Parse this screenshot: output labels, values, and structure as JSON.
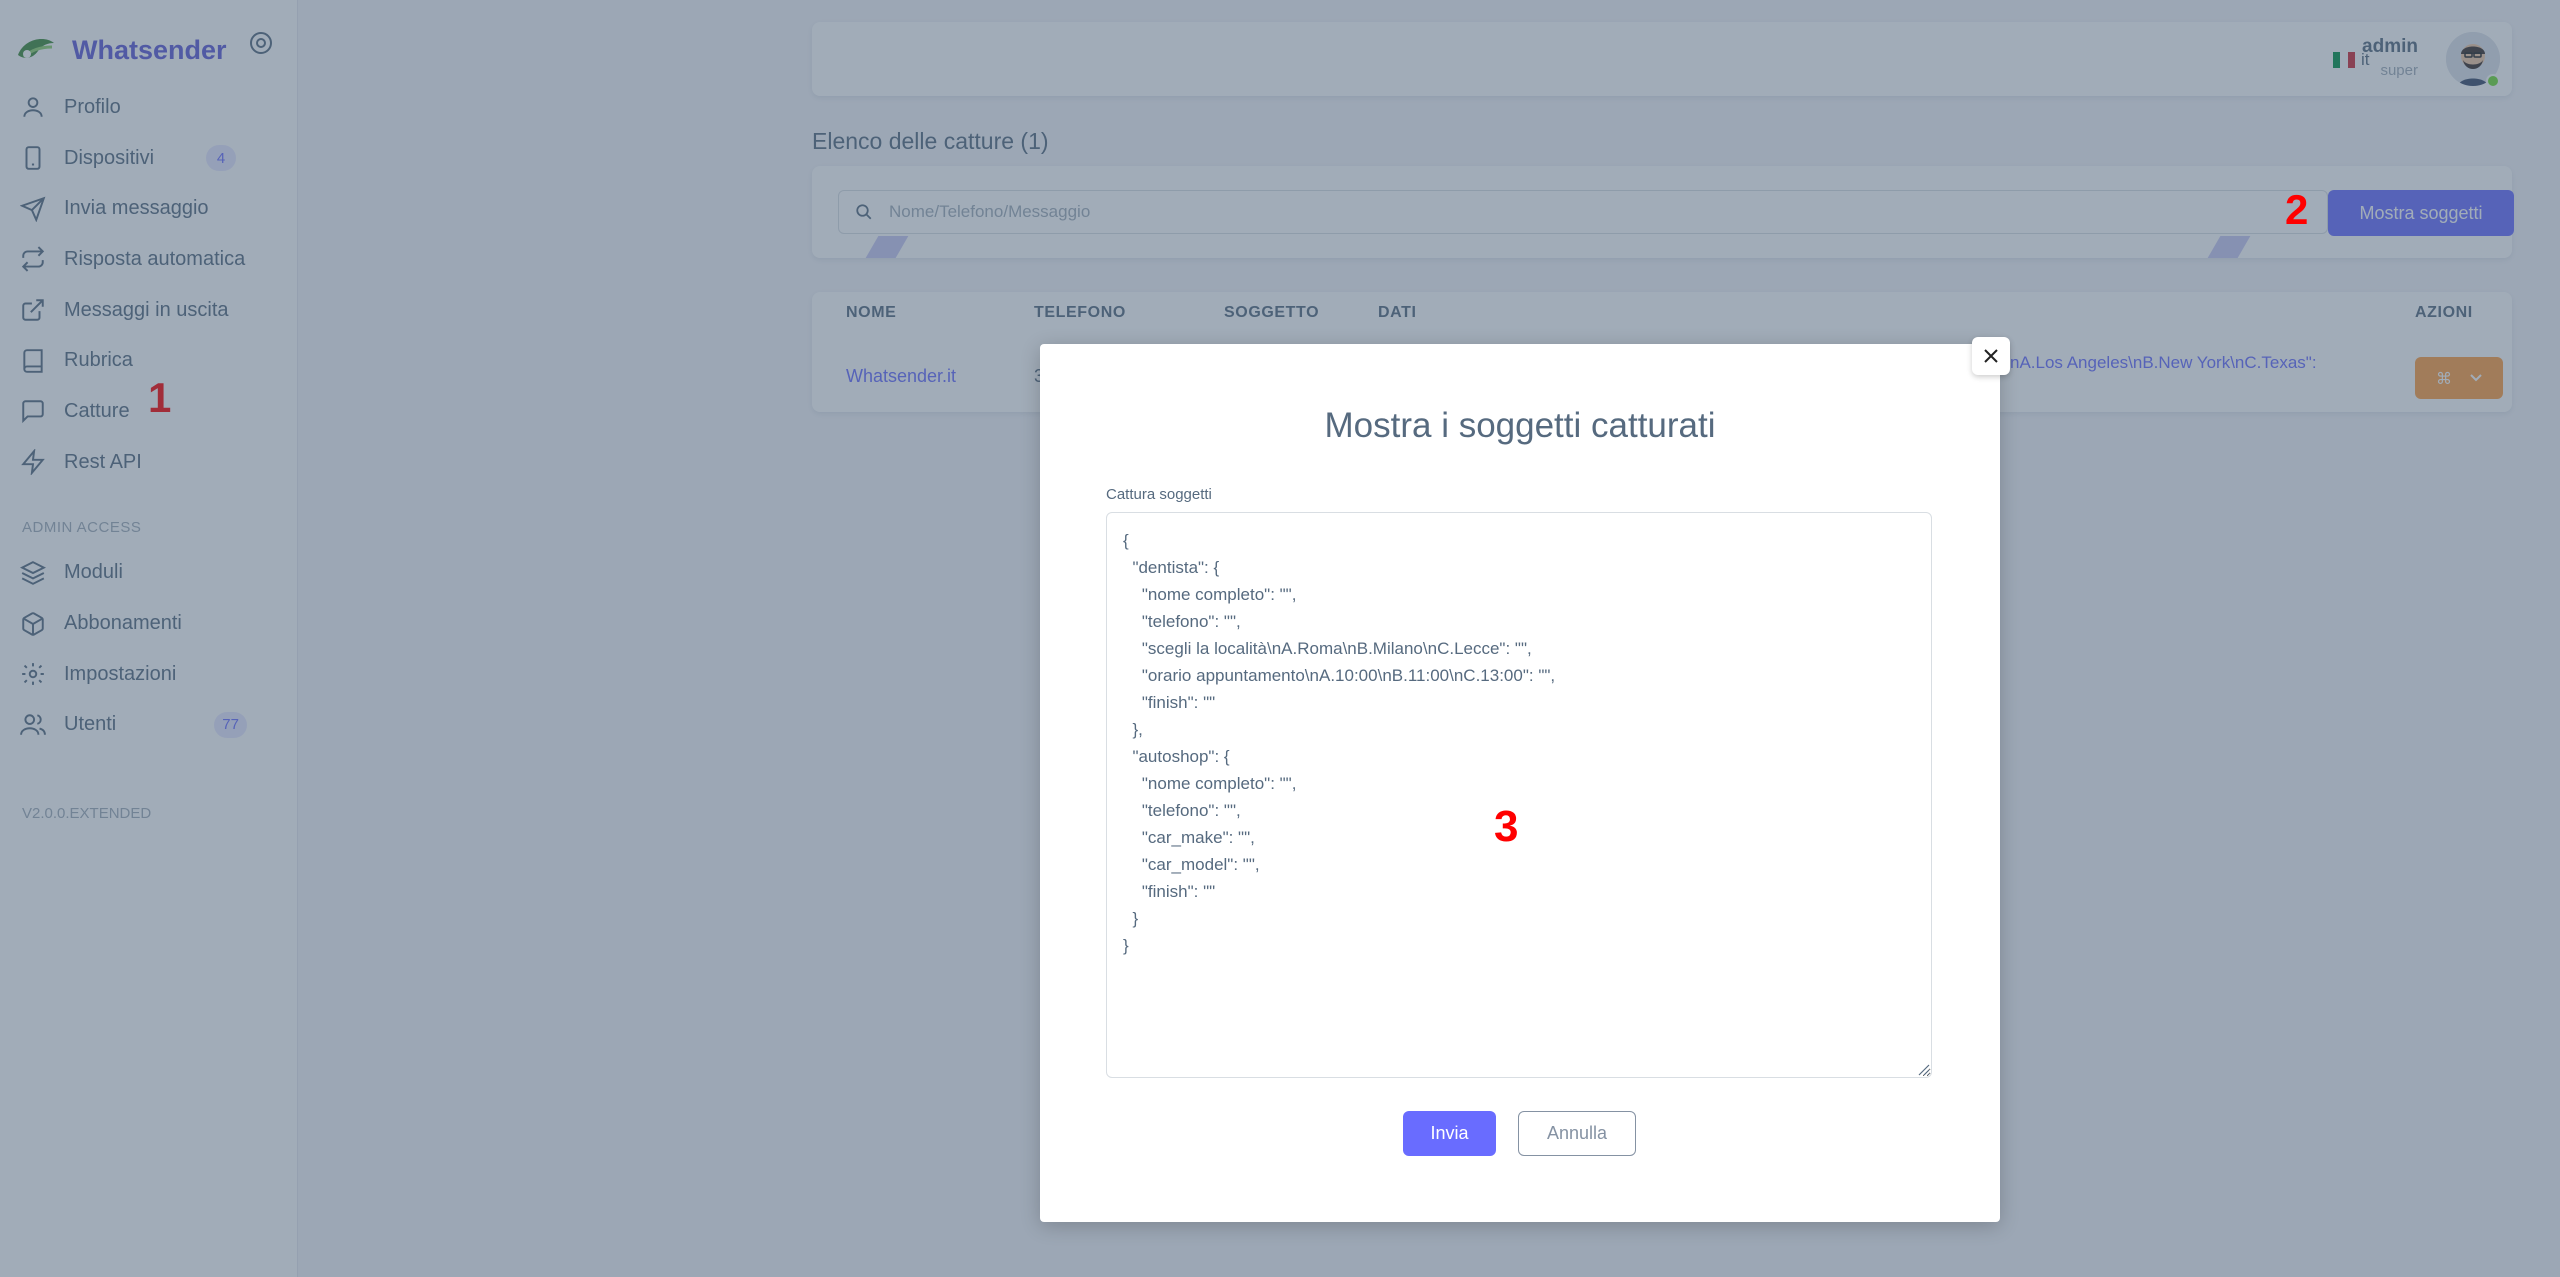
{
  "app": {
    "name": "Whatsender",
    "version": "V2.0.0.EXTENDED"
  },
  "sidebar": {
    "items": [
      {
        "label": "Profilo",
        "icon": "user-icon"
      },
      {
        "label": "Dispositivi",
        "icon": "smartphone-icon",
        "badge": "4"
      },
      {
        "label": "Invia messaggio",
        "icon": "send-icon"
      },
      {
        "label": "Risposta automatica",
        "icon": "repeat-icon"
      },
      {
        "label": "Messaggi in uscita",
        "icon": "external-link-icon"
      },
      {
        "label": "Rubrica",
        "icon": "book-icon"
      },
      {
        "label": "Catture",
        "icon": "message-square-icon"
      },
      {
        "label": "Rest API",
        "icon": "zap-icon"
      }
    ],
    "admin_header": "ADMIN ACCESS",
    "admin_items": [
      {
        "label": "Moduli",
        "icon": "layers-icon"
      },
      {
        "label": "Abbonamenti",
        "icon": "package-icon"
      },
      {
        "label": "Impostazioni",
        "icon": "settings-icon"
      },
      {
        "label": "Utenti",
        "icon": "users-icon",
        "badge": "77"
      }
    ]
  },
  "navbar": {
    "lang": "it",
    "user_name": "admin",
    "user_role": "super"
  },
  "page": {
    "title": "Elenco delle catture (1)",
    "search_placeholder": "Nome/Telefono/Messaggio",
    "show_button": "Mostra soggetti"
  },
  "table": {
    "headers": [
      "NOME",
      "TELEFONO",
      "SOGGETTO",
      "DATI",
      "AZIONI"
    ],
    "rows": [
      {
        "nome": "Whatsender.it",
        "telefono": "3",
        "dati": "nA.Los Angeles\\nB.New York\\nC.Texas\":"
      }
    ]
  },
  "modal": {
    "title": "Mostra i soggetti catturati",
    "field_label": "Cattura soggetti",
    "textarea_value": "{\n  \"dentista\": {\n    \"nome completo\": \"\",\n    \"telefono\": \"\",\n    \"scegli la località\\nA.Roma\\nB.Milano\\nC.Lecce\": \"\",\n    \"orario appuntamento\\nA.10:00\\nB.11:00\\nC.13:00\": \"\",\n    \"finish\": \"\"\n  },\n  \"autoshop\": {\n    \"nome completo\": \"\",\n    \"telefono\": \"\",\n    \"car_make\": \"\",\n    \"car_model\": \"\",\n    \"finish\": \"\"\n  }\n}",
    "submit_label": "Invia",
    "cancel_label": "Annulla"
  },
  "annotations": [
    "1",
    "2",
    "3"
  ],
  "colors": {
    "primary": "#696cff",
    "warning": "#ff9f43",
    "text": "#566a7f",
    "annotation": "#ff0000"
  }
}
